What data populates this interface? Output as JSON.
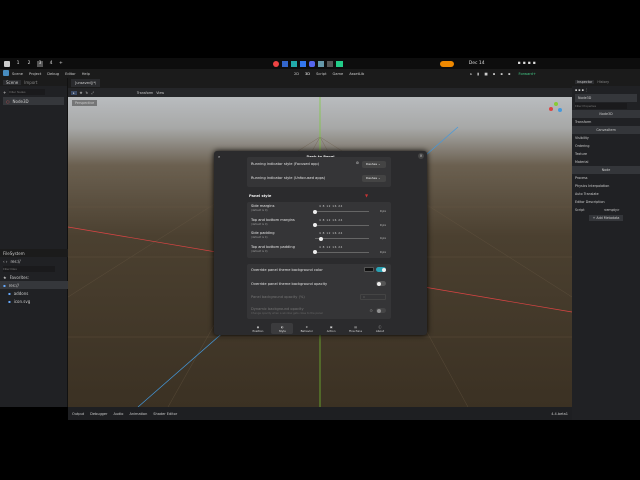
{
  "topbar": {
    "workspaces": [
      "1",
      "2",
      "3",
      "4"
    ],
    "add": "+",
    "clock": "Dec 14"
  },
  "menu": [
    "Scene",
    "Project",
    "Debug",
    "Editor",
    "Help"
  ],
  "main_screens": [
    "2D",
    "3D",
    "Script",
    "Game",
    "AssetLib"
  ],
  "renderer": "Forward+",
  "scene_dock": {
    "tabs": [
      "Scene",
      "Import"
    ],
    "filter_placeholder": "Filter Nodes",
    "root": "Node3D"
  },
  "filesystem": {
    "title": "FileSystem",
    "path": "res://",
    "filter_placeholder": "Filter Files",
    "items": [
      "Favorites:",
      "res://",
      "addons",
      "icon.svg"
    ]
  },
  "scene_tab": "[unsaved](*)",
  "toolbar": {
    "transform": "Transform",
    "view": "View"
  },
  "viewport": {
    "perspective": "Perspective"
  },
  "inspector": {
    "tabs": [
      "Inspector",
      "History"
    ],
    "node": "Node3D",
    "filter_placeholder": "Filter Properties",
    "sections": [
      {
        "header": "Node3D",
        "items": [
          "Transform"
        ]
      },
      {
        "header": "CanvasItem",
        "items": [
          "Visibility",
          "Ordering",
          "Texture",
          "Material"
        ]
      },
      {
        "header": "Node",
        "items": [
          "Process",
          "Physics Interpolation",
          "Auto Translate",
          "Editor Description"
        ]
      }
    ],
    "script_label": "Script",
    "script_value": "<empty>",
    "add_metadata": "+ Add Metadata"
  },
  "bottom_panel": {
    "tabs": [
      "Output",
      "Debugger",
      "Audio",
      "Animation",
      "Shader Editor"
    ],
    "version": "4.4.beta1"
  },
  "dialog": {
    "title": "Dash to Panel",
    "running": [
      {
        "label": "Running indicator style (Focused app)",
        "value": "Dashes"
      },
      {
        "label": "Running indicator style (Unfocused apps)",
        "value": "Dashes"
      }
    ],
    "panel_style_title": "Panel style",
    "ticks": "4  8  12 16    24",
    "sliders": [
      {
        "label": "Side margins",
        "sub": "(default is 0)",
        "value": "0 px",
        "fraction": 0
      },
      {
        "label": "Top and bottom margins",
        "sub": "(default is 0)",
        "value": "0 px",
        "fraction": 0
      },
      {
        "label": "Side padding",
        "sub": "(default is 4)",
        "value": "4 px",
        "fraction": 0.12
      },
      {
        "label": "Top and bottom padding",
        "sub": "(default is 0)",
        "value": "0 px",
        "fraction": 0
      }
    ],
    "options": [
      {
        "label": "Override panel theme background color",
        "on": true
      },
      {
        "label": "Override panel theme background opacity",
        "on": false
      },
      {
        "label": "Panel background opacity (%)",
        "value": "0",
        "disabled": true
      },
      {
        "label": "Dynamic background opacity",
        "sub": "Change opacity when a window gets close to the panel",
        "on": false,
        "disabled": true
      }
    ],
    "nav": [
      "Position",
      "Style",
      "Behavior",
      "Action",
      "Fine-Tune",
      "About"
    ],
    "accent": "#2aa1b3"
  }
}
